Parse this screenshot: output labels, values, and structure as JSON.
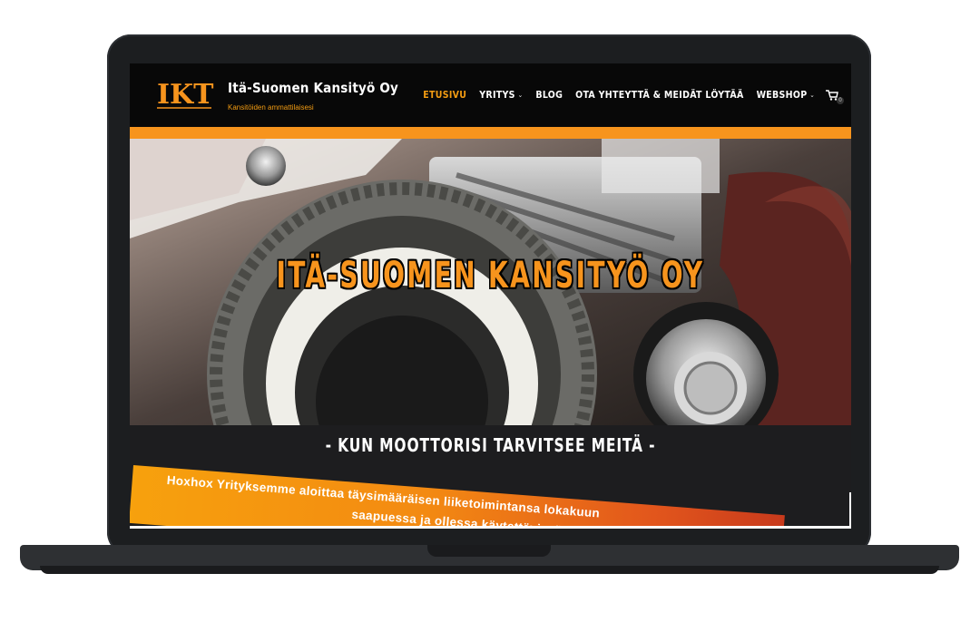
{
  "header": {
    "logo_text": "IKT",
    "brand_title": "Itä-Suomen Kansityö Oy",
    "tagline": "Kansitöiden ammattilaisesi"
  },
  "nav": {
    "items": [
      {
        "label": "ETUSIVU",
        "active": true,
        "dropdown": false
      },
      {
        "label": "YRITYS",
        "active": false,
        "dropdown": true
      },
      {
        "label": "BLOG",
        "active": false,
        "dropdown": false
      },
      {
        "label": "OTA YHTEYTTÄ & MEIDÄT LÖYTÄÄ",
        "active": false,
        "dropdown": false
      },
      {
        "label": "WEBSHOP",
        "active": false,
        "dropdown": true
      }
    ],
    "cart_icon": "cart-icon",
    "cart_count": "0"
  },
  "hero": {
    "title": "ITÄ-SUOMEN KANSITYÖ OY"
  },
  "section": {
    "heading": "- KUN MOOTTORISI TARVITSEE MEITÄ -",
    "banner_line1": "Hoxhox Yrityksemme aloittaa täysimääräisen liiketoimintansa lokakuun",
    "banner_line2": "saapuessa ja ollessa käytettävissä"
  },
  "colors": {
    "accent": "#f7941d",
    "header_bg": "#080808",
    "section_bg": "#1d1d1f"
  }
}
